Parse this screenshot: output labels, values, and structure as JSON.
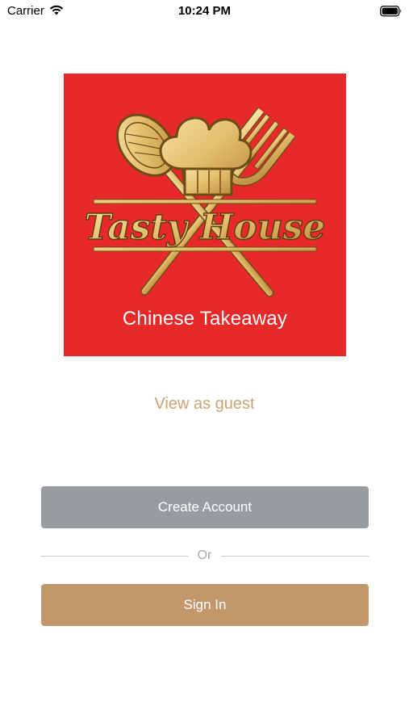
{
  "status_bar": {
    "carrier": "Carrier",
    "time": "10:24 PM"
  },
  "logo": {
    "title": "Tasty House",
    "subtitle": "Chinese Takeaway",
    "background_color": "#e8292a",
    "accent_color": "#e7c57a"
  },
  "guest_link": {
    "label": "View as guest",
    "color": "#c9a472"
  },
  "actions": {
    "create_account_label": "Create Account",
    "create_account_color": "#989ca1",
    "divider_label": "Or",
    "sign_in_label": "Sign In",
    "sign_in_color": "#c2976b"
  },
  "icons": {
    "wifi": "wifi-icon",
    "battery": "battery-icon",
    "chef_hat": "chef-hat-icon",
    "fork": "fork-icon",
    "spoon": "spoon-icon"
  }
}
